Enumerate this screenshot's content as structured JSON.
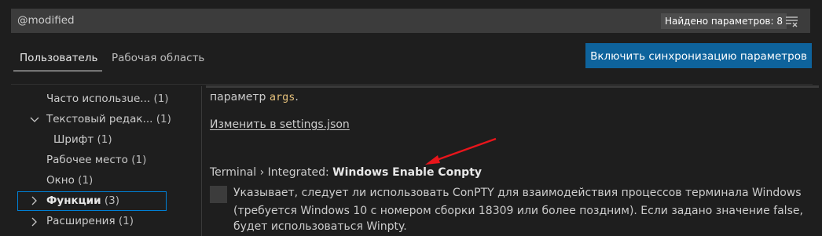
{
  "search": {
    "value": "@modified",
    "count_label": "Найдено параметров: 8",
    "clear_icon": "clear-filter-icon"
  },
  "tabs": [
    {
      "label": "Пользователь"
    },
    {
      "label": "Рабочая область"
    }
  ],
  "sync_button": {
    "label": "Включить синхронизацию параметров"
  },
  "toc": [
    {
      "label": "Часто использue...",
      "count": "(1)"
    },
    {
      "label": "Текстовый редак...",
      "count": "(1)"
    },
    {
      "label": "Шрифт",
      "count": "(1)"
    },
    {
      "label": "Рабочее место",
      "count": "(1)"
    },
    {
      "label": "Окно",
      "count": "(1)"
    },
    {
      "label": "Функции",
      "count": "(3)"
    },
    {
      "label": "Расширения",
      "count": "(1)"
    }
  ],
  "prev_setting": {
    "text_before": "параметр ",
    "code": "args",
    "text_after": ".",
    "edit_link": "Изменить в settings.json"
  },
  "setting": {
    "category": "Terminal › Integrated: ",
    "name": "Windows Enable Conpty",
    "description": [
      "Указывает, следует ли использовать ConPTY для взаимодействия процессов терминала Windows",
      "(требуется Windows 10 с номером сборки 18309 или более поздним). Если задано значение false,",
      "будет использоваться Winpty."
    ]
  },
  "colors": {
    "accent": "#0e639c",
    "focus_border": "#007fd4",
    "annotation_arrow": "#e8151b"
  }
}
